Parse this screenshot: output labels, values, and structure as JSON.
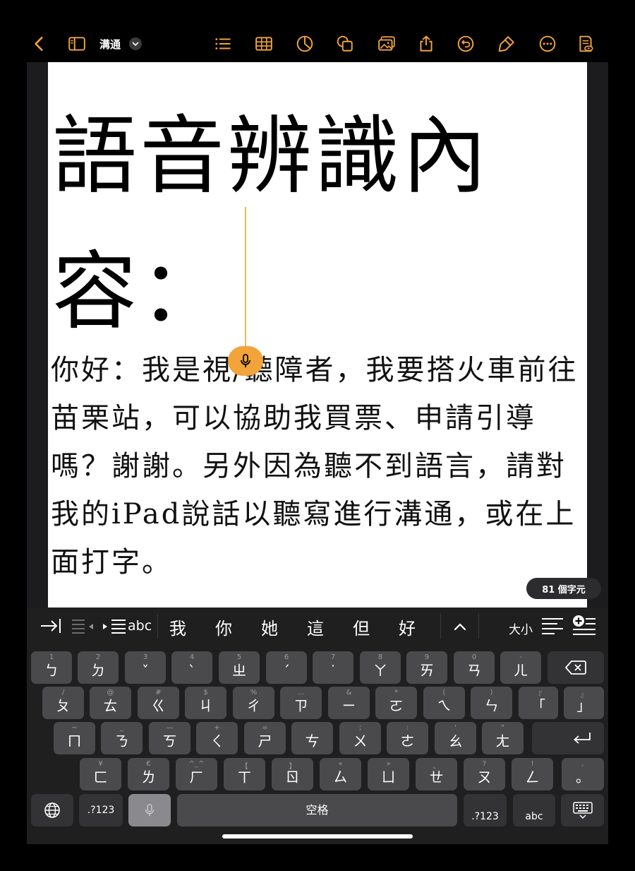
{
  "toolbar": {
    "doc_title": "溝通"
  },
  "document": {
    "heading": "語音辨識內容：",
    "body": "你好：我是視/聽障者，我要搭火車前往苗栗站，可以協助我買票、申請引導嗎？謝謝。另外因為聽不到語言，請對我的iPad說話以聽寫進行溝通，或在上面打字。"
  },
  "status": {
    "char_count": "81 個字元"
  },
  "suggestions": {
    "abc_label": "abc",
    "candidates": [
      "我",
      "你",
      "她",
      "這",
      "但",
      "好"
    ],
    "size_label": "大小"
  },
  "keyboard": {
    "rows": [
      [
        {
          "sec": "1",
          "pri": "ㄅ"
        },
        {
          "sec": "2",
          "pri": "ㄉ"
        },
        {
          "sec": "3",
          "pri": "ˇ"
        },
        {
          "sec": "4",
          "pri": "ˋ"
        },
        {
          "sec": "5",
          "pri": "ㄓ"
        },
        {
          "sec": "6",
          "pri": "ˊ"
        },
        {
          "sec": "7",
          "pri": "˙"
        },
        {
          "sec": "8",
          "pri": "ㄚ"
        },
        {
          "sec": "9",
          "pri": "ㄞ"
        },
        {
          "sec": "0",
          "pri": "ㄢ"
        },
        {
          "sec": "-",
          "pri": "ㄦ"
        }
      ],
      [
        {
          "sec": "/",
          "pri": "ㄆ"
        },
        {
          "sec": "@",
          "pri": "ㄊ"
        },
        {
          "sec": "#",
          "pri": "ㄍ"
        },
        {
          "sec": "$",
          "pri": "ㄐ"
        },
        {
          "sec": "%",
          "pri": "ㄔ"
        },
        {
          "sec": "…",
          "pri": "ㄗ"
        },
        {
          "sec": "&",
          "pri": "ㄧ"
        },
        {
          "sec": "*",
          "pri": "ㄛ"
        },
        {
          "sec": "(",
          "pri": "ㄟ"
        },
        {
          "sec": ")",
          "pri": "ㄣ"
        },
        {
          "sec": "『",
          "pri": "「"
        },
        {
          "sec": "』",
          "pri": "」"
        }
      ],
      [
        {
          "sec": "~",
          "pri": "ㄇ"
        },
        {
          "sec": "_",
          "pri": "ㄋ"
        },
        {
          "sec": "—",
          "pri": "ㄎ"
        },
        {
          "sec": "+",
          "pri": "ㄑ"
        },
        {
          "sec": "=",
          "pri": "ㄕ"
        },
        {
          "sec": "",
          "pri": "ㄘ"
        },
        {
          "sec": ";",
          "pri": "ㄨ"
        },
        {
          "sec": ":",
          "pri": "ㄜ"
        },
        {
          "sec": "'",
          "pri": "ㄠ"
        },
        {
          "sec": "\"",
          "pri": "ㄤ"
        }
      ],
      [
        {
          "sec": "¥",
          "pri": "ㄈ"
        },
        {
          "sec": "€",
          "pri": "ㄌ"
        },
        {
          "sec": "^_^",
          "pri": "ㄏ"
        },
        {
          "sec": "【",
          "pri": "ㄒ"
        },
        {
          "sec": "】",
          "pri": "ㄖ"
        },
        {
          "sec": "«",
          "pri": "ㄙ"
        },
        {
          "sec": "»",
          "pri": "ㄩ"
        },
        {
          "sec": "、",
          "pri": "ㄝ"
        },
        {
          "sec": "?",
          "pri": "ㄡ"
        },
        {
          "sec": "!",
          "pri": "ㄥ"
        },
        {
          "sec": ",",
          "pri": "。"
        }
      ]
    ],
    "numbers_label": ".?123",
    "space_label": "空格",
    "abc_label": "abc"
  },
  "colors": {
    "accent": "#f2a33a",
    "key": "#4a4a4c",
    "key_dark": "#333335",
    "keyboard_bg": "#1f1f20"
  }
}
